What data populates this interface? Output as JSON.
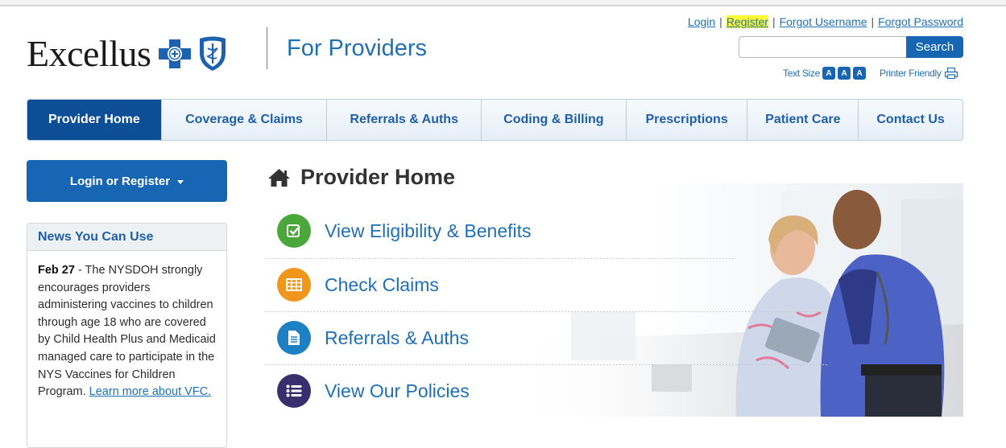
{
  "brand": {
    "wordmark": "Excellus",
    "section": "For Providers"
  },
  "toplinks": {
    "login": "Login",
    "sep": "|",
    "register": "Register",
    "forgot_username": "Forgot Username",
    "forgot_password": "Forgot Password"
  },
  "search": {
    "placeholder": "",
    "button": "Search"
  },
  "textsize": {
    "label": "Text Size",
    "btn": "A",
    "printer": "Printer Friendly"
  },
  "nav": [
    {
      "label": "Provider Home"
    },
    {
      "label": "Coverage & Claims"
    },
    {
      "label": "Referrals & Auths"
    },
    {
      "label": "Coding & Billing"
    },
    {
      "label": "Prescriptions"
    },
    {
      "label": "Patient Care"
    },
    {
      "label": "Contact Us"
    }
  ],
  "sidebar": {
    "login_button": "Login or Register",
    "news_title": "News You Can Use",
    "news_date": "Feb 27",
    "news_text": " - The NYSDOH strongly encourages providers administering vaccines to children through age 18 who are covered by Child Health Plus and Medicaid managed care to participate in the NYS Vaccines for Children Program. ",
    "news_link": "Learn more about VFC."
  },
  "main": {
    "title": "Provider Home",
    "actions": [
      {
        "label": "View Eligibility & Benefits",
        "icon": "check-square-icon",
        "color": "#4aa83a"
      },
      {
        "label": "Check Claims",
        "icon": "table-icon",
        "color": "#f0961c"
      },
      {
        "label": "Referrals & Auths",
        "icon": "document-icon",
        "color": "#1d7fc4"
      },
      {
        "label": "View Our Policies",
        "icon": "list-icon",
        "color": "#3a2f6e"
      }
    ]
  },
  "colors": {
    "primary": "#1766b3",
    "nav_active": "#0d4f96",
    "link": "#1f6fb5",
    "highlight": "#ffff33"
  }
}
